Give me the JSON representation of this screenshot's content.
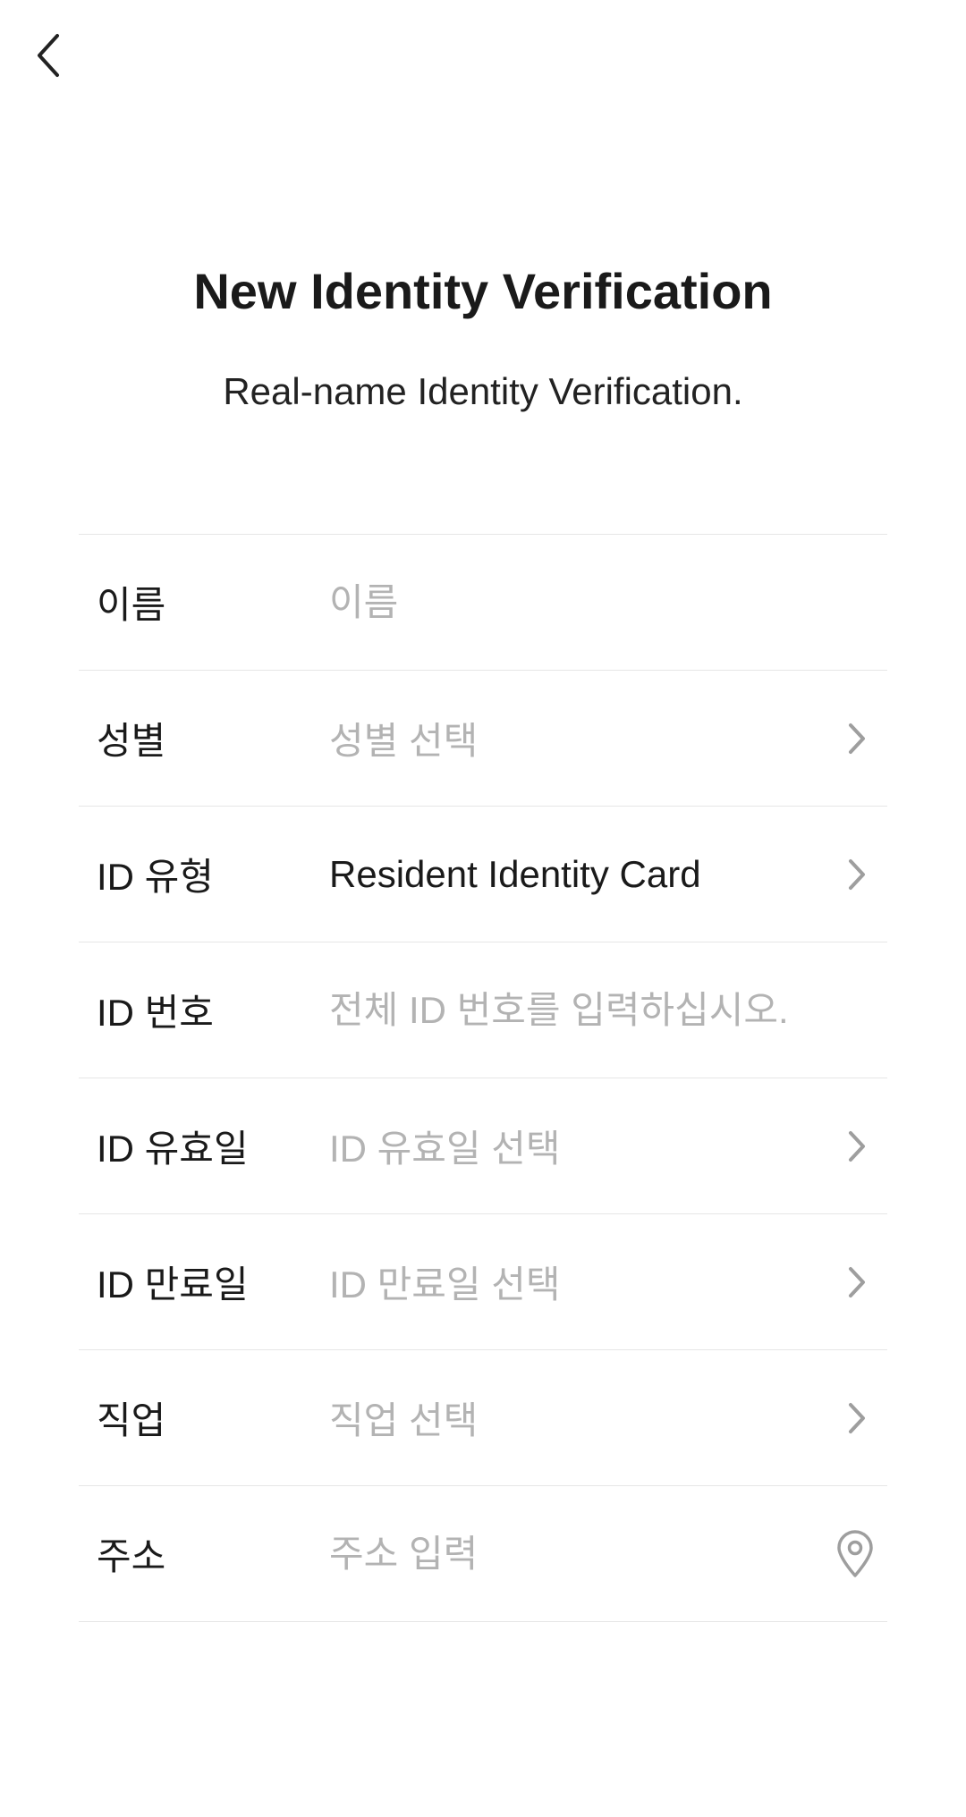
{
  "header": {
    "back_icon": "chevron-left-icon",
    "title": "New Identity Verification",
    "subtitle": "Real-name Identity Verification."
  },
  "form": {
    "rows": [
      {
        "label": "이름",
        "placeholder": "이름",
        "value": "",
        "kind": "input",
        "trailing_icon": ""
      },
      {
        "label": "성별",
        "placeholder": "성별 선택",
        "value": "",
        "kind": "select",
        "trailing_icon": "chevron-right-icon"
      },
      {
        "label": "ID 유형",
        "placeholder": "",
        "value": "Resident Identity Card",
        "kind": "select",
        "trailing_icon": "chevron-right-icon"
      },
      {
        "label": "ID 번호",
        "placeholder": "전체 ID 번호를 입력하십시오.",
        "value": "",
        "kind": "input",
        "trailing_icon": ""
      },
      {
        "label": "ID 유효일",
        "placeholder": "ID 유효일 선택",
        "value": "",
        "kind": "select",
        "trailing_icon": "chevron-right-icon"
      },
      {
        "label": "ID 만료일",
        "placeholder": "ID 만료일 선택",
        "value": "",
        "kind": "select",
        "trailing_icon": "chevron-right-icon"
      },
      {
        "label": "직업",
        "placeholder": "직업 선택",
        "value": "",
        "kind": "select",
        "trailing_icon": "chevron-right-icon"
      },
      {
        "label": "주소",
        "placeholder": "주소 입력",
        "value": "",
        "kind": "input",
        "trailing_icon": "location-pin-icon"
      }
    ]
  },
  "colors": {
    "text_primary": "#1a1a1a",
    "placeholder": "#b3b3b3",
    "divider": "#e6e6e6",
    "icon_gray": "#9e9e9e"
  }
}
